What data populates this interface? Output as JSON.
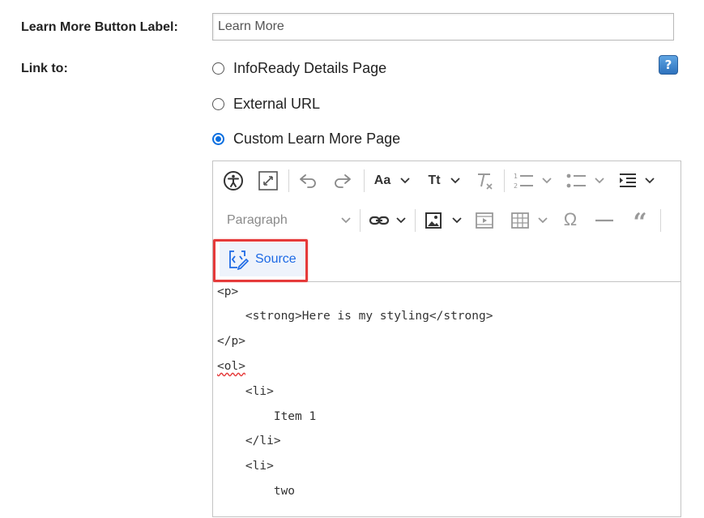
{
  "form": {
    "button_label": {
      "label": "Learn More Button Label:",
      "value": "Learn More"
    },
    "link_to": {
      "label": "Link to:",
      "help": "?",
      "options": [
        {
          "label": "InfoReady Details Page",
          "checked": false
        },
        {
          "label": "External URL",
          "checked": false
        },
        {
          "label": "Custom Learn More Page",
          "checked": true
        }
      ]
    }
  },
  "editor": {
    "toolbar": {
      "font_family_label": "Aa",
      "font_size_label": "Tt",
      "paragraph_label": "Paragraph",
      "source_label": "Source",
      "icons": [
        "accessibility-icon",
        "fullscreen-icon",
        "undo-icon",
        "redo-icon",
        "font-family-icon",
        "font-size-icon",
        "remove-format-icon",
        "numbered-list-icon",
        "bulleted-list-icon",
        "indent-icon",
        "link-icon",
        "image-icon",
        "media-icon",
        "table-icon",
        "special-char-icon",
        "horizontal-line-icon",
        "blockquote-icon",
        "source-icon"
      ]
    },
    "source": {
      "lines": [
        "<p>",
        "    <strong>Here is my styling</strong>",
        "</p>",
        "<ol>",
        "    <li>",
        "        Item 1",
        "    </li>",
        "    <li>",
        "        two"
      ]
    }
  },
  "colors": {
    "accent": "#1d6ae5",
    "highlight": "#e53a3a",
    "radio": "#0b6fe0"
  }
}
